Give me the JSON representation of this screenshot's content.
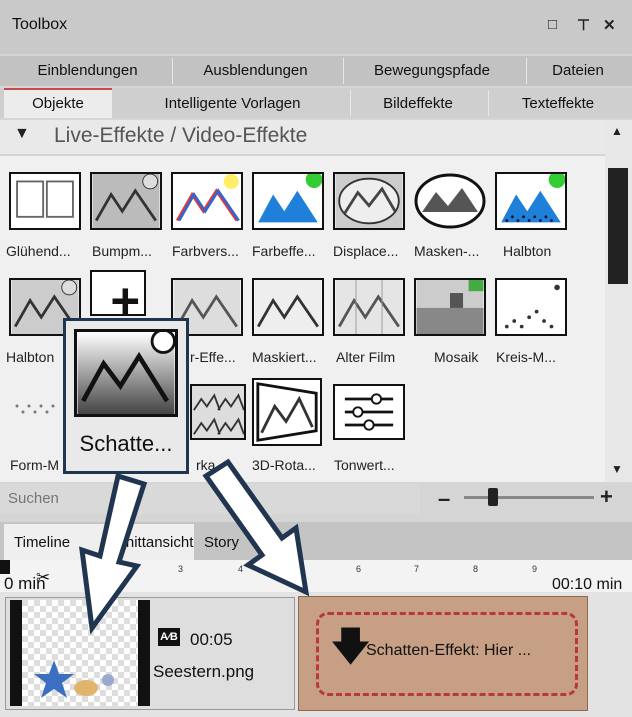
{
  "window": {
    "title": "Toolbox"
  },
  "tabs_row1": [
    "Einblendungen",
    "Ausblendungen",
    "Bewegungspfade",
    "Dateien"
  ],
  "tabs_row2": [
    "Objekte",
    "Intelligente Vorlagen",
    "Bildeffekte",
    "Texteffekte"
  ],
  "section": {
    "title": "Live-Effekte / Video-Effekte"
  },
  "effects_row1": [
    "Glühend...",
    "Bumpm...",
    "Farbvers...",
    "Farbeffe...",
    "Displace...",
    "Masken-...",
    "Halbton"
  ],
  "effects_row2": [
    "Halbton",
    "",
    "r-Effe...",
    "Maskiert...",
    "Alter Film",
    "Mosaik",
    "Kreis-M..."
  ],
  "effects_row3": [
    "Form-M",
    "",
    "rka...",
    "3D-Rota...",
    "Tonwert..."
  ],
  "popup": {
    "label": "Schatte..."
  },
  "search": {
    "placeholder": "Suchen"
  },
  "timeline": {
    "tab1": "Timeline",
    "tab2": "Schnittansicht",
    "tab3": "Story",
    "ruler_start": "0 min",
    "ruler_end": "00:10 min",
    "ticks": [
      "3",
      "4",
      "6",
      "7",
      "8",
      "9"
    ],
    "clip1_duration": "00:05",
    "clip1_file": "Seestern.png",
    "clip2_text": "Schatten-Effekt: Hier ..."
  },
  "colors": {
    "accent": "#c84b4b",
    "arrow": "#1f3550",
    "dropzone": "#c79f84"
  }
}
